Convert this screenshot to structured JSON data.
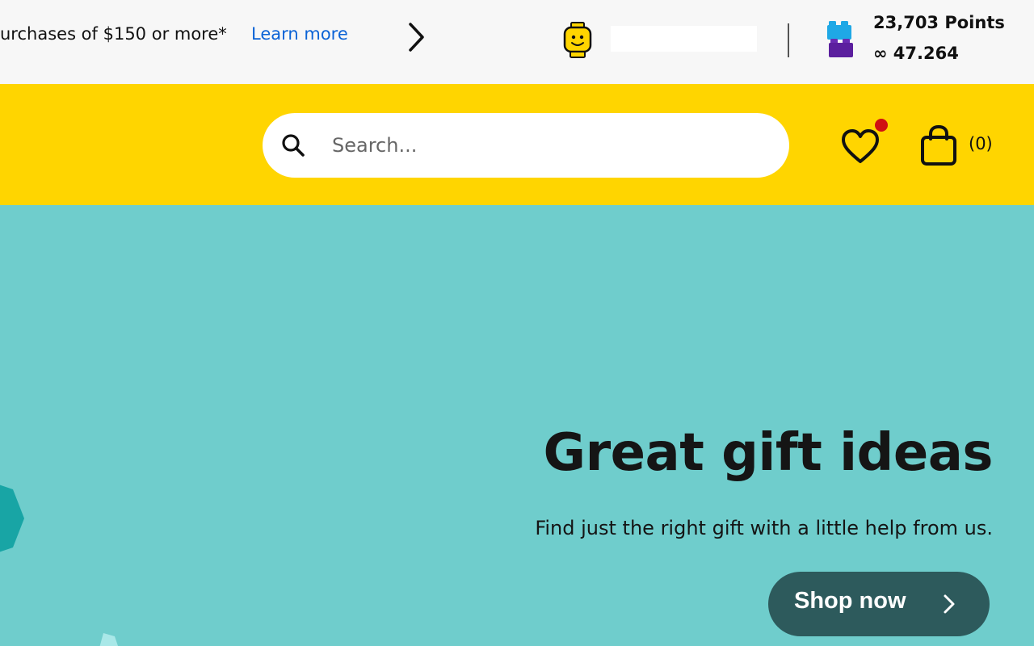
{
  "promo": {
    "text": "urchases of $150 or more*",
    "link_label": "Learn more",
    "next_icon": "chevron-right-icon"
  },
  "account": {
    "avatar_icon": "minifigure-head-icon",
    "username": ""
  },
  "rewards": {
    "icon": "lego-bricks-icon",
    "points": "23,703 Points",
    "insiders": "∞ 47.264"
  },
  "search": {
    "placeholder": "Search...",
    "value": "",
    "icon": "search-icon"
  },
  "header": {
    "wishlist_icon": "heart-icon",
    "bag_icon": "shopping-bag-icon",
    "bag_count": "(0)"
  },
  "hero": {
    "title": "Great gift ideas",
    "subtitle": "Find just the right gift with a little help from us.",
    "cta_label": "Shop now",
    "cta_icon": "chevron-right-icon"
  },
  "colors": {
    "header_yellow": "#ffd500",
    "hero_teal": "#6fcdcc",
    "cta_bg": "#2d5a5c",
    "link_blue": "#0b63d6",
    "notification_red": "#d01012"
  }
}
